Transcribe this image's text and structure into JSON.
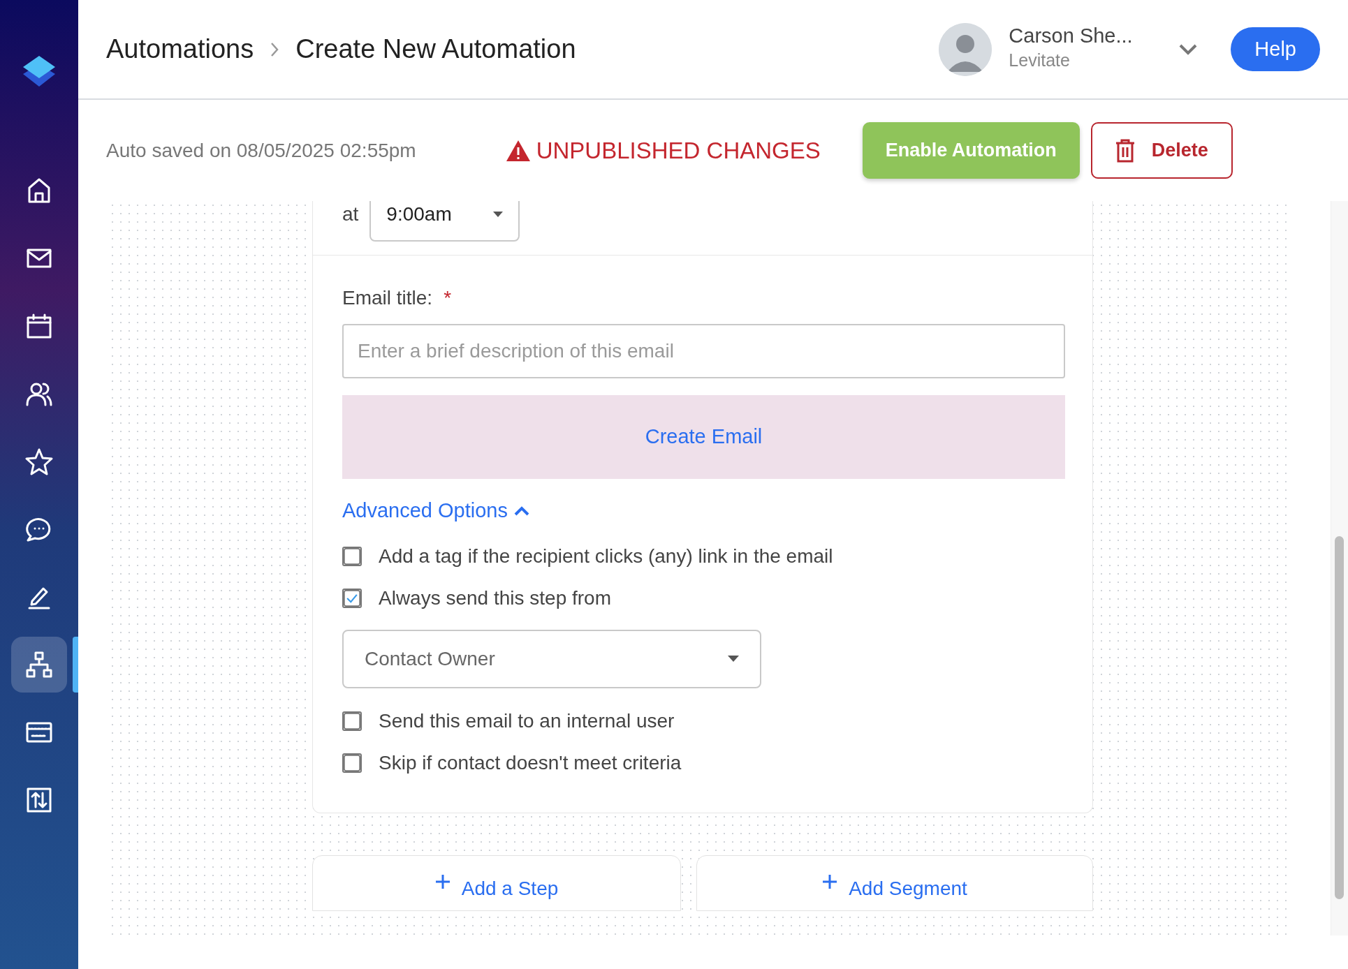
{
  "sidebar": {
    "items": [
      {
        "kind": "home",
        "selected": false
      },
      {
        "kind": "mail",
        "selected": false
      },
      {
        "kind": "calendar",
        "selected": false
      },
      {
        "kind": "users",
        "selected": false
      },
      {
        "kind": "star",
        "selected": false
      },
      {
        "kind": "chat",
        "selected": false
      },
      {
        "kind": "pen",
        "selected": false
      },
      {
        "kind": "sitemap",
        "selected": true
      },
      {
        "kind": "card",
        "selected": false
      },
      {
        "kind": "transfer",
        "selected": false
      }
    ]
  },
  "breadcrumb": [
    {
      "label": "Automations"
    },
    {
      "label": "Create New Automation"
    }
  ],
  "user": {
    "name": "Carson She...",
    "org": "Levitate"
  },
  "help_button": "Help",
  "toolbar": {
    "autosave": "Auto saved on 08/05/2025 02:55pm",
    "warning": "UNPUBLISHED CHANGES",
    "enable_button": "Enable Automation",
    "delete_button": "Delete"
  },
  "step": {
    "time_label": "at",
    "time_value": "9:00am",
    "email_title_label": "Email title:",
    "required_mark": "*",
    "email_title_placeholder": "Enter a brief description of this email",
    "create_email": "Create Email",
    "advanced_options": {
      "label": "Advanced Options",
      "expanded": true
    },
    "options": [
      {
        "kind": "checkbox",
        "label": "Add a tag if the recipient clicks (any) link in the email",
        "checked": false
      },
      {
        "kind": "checkbox",
        "label": "Always send this step from",
        "checked": true
      },
      {
        "kind": "select",
        "value": "Contact Owner"
      },
      {
        "kind": "checkbox",
        "label": "Send this email to an internal user",
        "checked": false
      },
      {
        "kind": "checkbox",
        "label": "Skip if contact doesn't meet criteria",
        "checked": false
      }
    ]
  },
  "add_buttons": [
    {
      "label": "Add a Step"
    },
    {
      "label": "Add Segment"
    }
  ]
}
